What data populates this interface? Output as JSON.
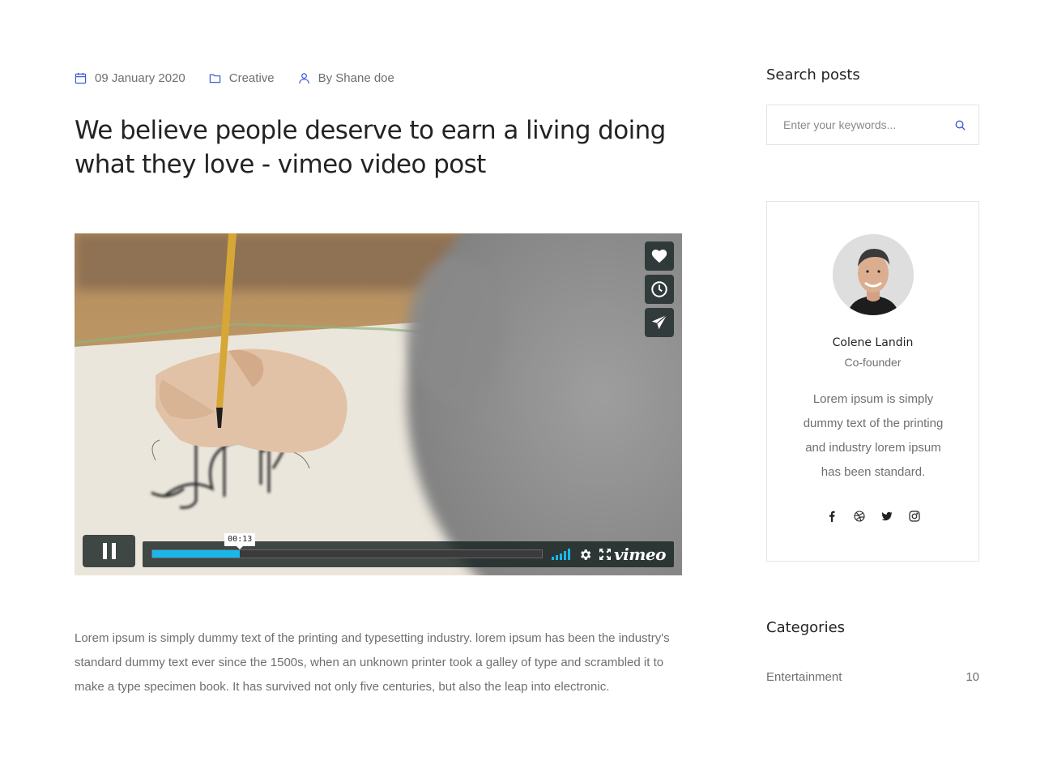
{
  "post": {
    "meta": {
      "date": "09 January 2020",
      "category": "Creative",
      "author": "By Shane doe"
    },
    "title": "We believe people deserve to earn a living doing what they love - vimeo video post",
    "body": "Lorem ipsum is simply dummy text of the printing and typesetting industry. lorem ipsum has been the industry's standard dummy text ever since the 1500s, when an unknown printer took a galley of type and scrambled it to make a type specimen book. It has survived not only five centuries, but also the leap into electronic."
  },
  "video": {
    "current_time": "00:13",
    "progress_fraction": 0.225,
    "brand": "vimeo",
    "accent_color": "#1ab7ea",
    "side_buttons": [
      "heart-icon",
      "clock-icon",
      "paper-plane-icon"
    ],
    "controls": [
      "pause-icon",
      "volume-icon",
      "settings-gear-icon",
      "fullscreen-icon"
    ]
  },
  "sidebar": {
    "search": {
      "title": "Search posts",
      "placeholder": "Enter your keywords..."
    },
    "author": {
      "name": "Colene Landin",
      "role": "Co-founder",
      "bio": "Lorem ipsum is simply dummy text of the printing and industry lorem ipsum has been standard.",
      "socials": [
        "facebook-icon",
        "dribbble-icon",
        "twitter-icon",
        "instagram-icon"
      ]
    },
    "categories": {
      "title": "Categories",
      "items": [
        {
          "name": "Entertainment",
          "count": "10"
        }
      ]
    }
  },
  "colors": {
    "icon_accent": "#3a5bd9",
    "text_dark": "#232323",
    "text_muted": "#6f6f6f"
  }
}
